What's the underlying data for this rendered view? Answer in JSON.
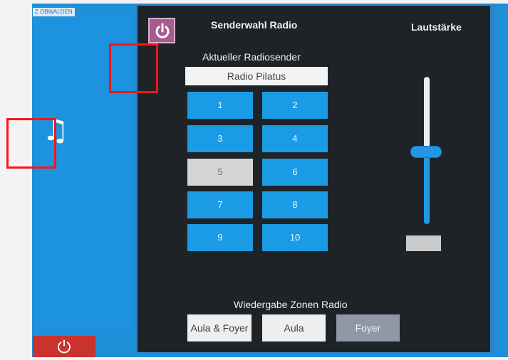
{
  "top_tag": "Z OBWALDEN",
  "left_nav": {
    "music_icon": "music-note-icon",
    "power_icon": "power-icon"
  },
  "header": {
    "power_icon": "power-icon",
    "title": "Senderwahl Radio",
    "volume_title": "Lautstärke"
  },
  "radio": {
    "current_label": "Aktueller Radiosender",
    "current_station": "Radio Pilatus",
    "presets": [
      "1",
      "2",
      "3",
      "4",
      "5",
      "6",
      "7",
      "8",
      "9",
      "10"
    ],
    "selected_preset": "5"
  },
  "volume": {
    "level": 0.56
  },
  "zones": {
    "label": "Wiedergabe Zonen Radio",
    "items": [
      {
        "label": "Aula & Foyer",
        "active": true
      },
      {
        "label": "Aula",
        "active": true
      },
      {
        "label": "Foyer",
        "active": false
      }
    ]
  },
  "colors": {
    "accent": "#1b9be6",
    "panel": "#1e2327",
    "power_button": "#a85b8f",
    "marker": "#ff1515"
  }
}
